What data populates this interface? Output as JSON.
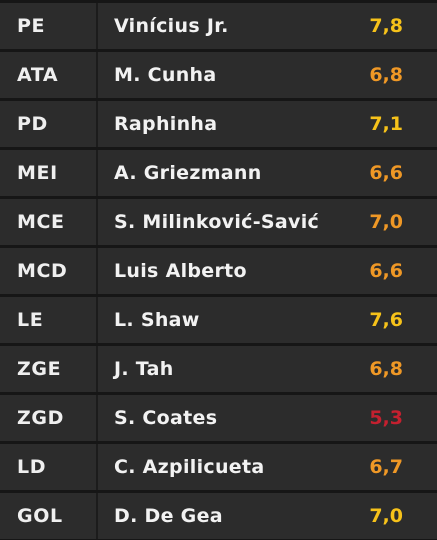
{
  "colors": {
    "rating_yellow": "#f6c21a",
    "rating_orange": "#ef9826",
    "rating_red": "#c4202f"
  },
  "players": [
    {
      "position": "PE",
      "name": "Vinícius Jr.",
      "rating": "7,8",
      "rating_color": "#f6c21a"
    },
    {
      "position": "ATA",
      "name": "M. Cunha",
      "rating": "6,8",
      "rating_color": "#ef9826"
    },
    {
      "position": "PD",
      "name": "Raphinha",
      "rating": "7,1",
      "rating_color": "#f6c21a"
    },
    {
      "position": "MEI",
      "name": "A. Griezmann",
      "rating": "6,6",
      "rating_color": "#ef9826"
    },
    {
      "position": "MCE",
      "name": "S. Milinković-Savić",
      "rating": "7,0",
      "rating_color": "#ef9826"
    },
    {
      "position": "MCD",
      "name": "Luis Alberto",
      "rating": "6,6",
      "rating_color": "#ef9826"
    },
    {
      "position": "LE",
      "name": "L. Shaw",
      "rating": "7,6",
      "rating_color": "#f6c21a"
    },
    {
      "position": "ZGE",
      "name": "J. Tah",
      "rating": "6,8",
      "rating_color": "#ef9826"
    },
    {
      "position": "ZGD",
      "name": "S. Coates",
      "rating": "5,3",
      "rating_color": "#c4202f"
    },
    {
      "position": "LD",
      "name": "C. Azpilicueta",
      "rating": "6,7",
      "rating_color": "#ef9826"
    },
    {
      "position": "GOL",
      "name": "D. De Gea",
      "rating": "7,0",
      "rating_color": "#f6c21a"
    }
  ]
}
